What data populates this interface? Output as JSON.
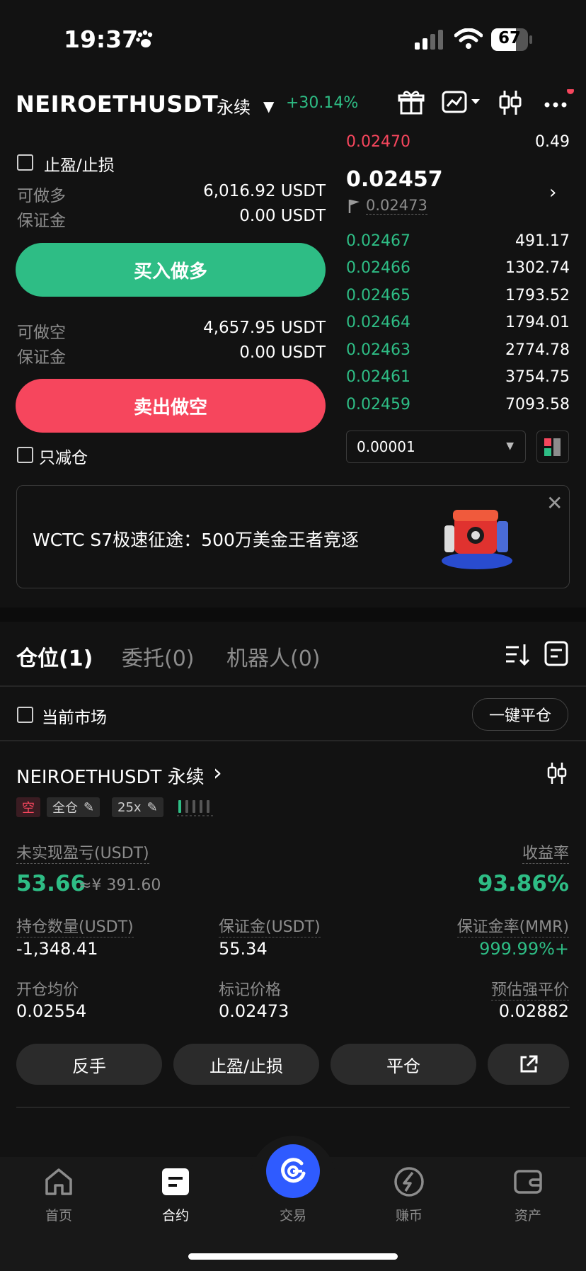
{
  "status_bar": {
    "time": "19:37",
    "battery": "67"
  },
  "header": {
    "pair": "NEIROETHUSDT",
    "contract_type": "永续",
    "change": "+30.14%"
  },
  "left_panel": {
    "tp_sl_label": "止盈/止损",
    "available_long_label": "可做多",
    "available_long_value": "6,016.92 USDT",
    "margin_long_label": "保证金",
    "margin_long_value": "0.00 USDT",
    "buy_long_label": "买入做多",
    "available_short_label": "可做空",
    "available_short_value": "4,657.95 USDT",
    "margin_short_label": "保证金",
    "margin_short_value": "0.00 USDT",
    "sell_short_label": "卖出做空",
    "reduce_only_label": "只减仓"
  },
  "order_book": {
    "ask_price": "0.02470",
    "ask_qty": "0.49",
    "last_price": "0.02457",
    "mark_price": "0.02473",
    "bids": [
      {
        "price": "0.02467",
        "qty": "491.17"
      },
      {
        "price": "0.02466",
        "qty": "1302.74"
      },
      {
        "price": "0.02465",
        "qty": "1793.52"
      },
      {
        "price": "0.02464",
        "qty": "1794.01"
      },
      {
        "price": "0.02463",
        "qty": "2774.78"
      },
      {
        "price": "0.02461",
        "qty": "3754.75"
      },
      {
        "price": "0.02459",
        "qty": "7093.58"
      }
    ],
    "precision": "0.00001"
  },
  "banner": {
    "text": "WCTC S7极速征途：500万美金王者竞逐"
  },
  "tabs": {
    "positions": "仓位(1)",
    "orders": "委托(0)",
    "bots": "机器人(0)"
  },
  "filter": {
    "current_market_label": "当前市场",
    "close_all_label": "一键平仓"
  },
  "position": {
    "title": "NEIROETHUSDT 永续",
    "side_tag": "空",
    "margin_mode_tag": "全仓",
    "leverage_tag": "25x",
    "unrealized_label": "未实现盈亏(USDT)",
    "unrealized_value": "53.66",
    "unrealized_cny": "≈¥ 391.60",
    "roi_label": "收益率",
    "roi_value": "93.86%",
    "size_label": "持仓数量(USDT)",
    "size_value": "-1,348.41",
    "margin_label": "保证金(USDT)",
    "margin_value": "55.34",
    "mmr_label": "保证金率(MMR)",
    "mmr_value": "999.99%+",
    "entry_label": "开仓均价",
    "entry_value": "0.02554",
    "mark_label": "标记价格",
    "mark_value": "0.02473",
    "liq_label": "预估强平价",
    "liq_value": "0.02882",
    "btn_reverse": "反手",
    "btn_tpsl": "止盈/止损",
    "btn_close": "平仓"
  },
  "nav": {
    "home": "首页",
    "futures": "合约",
    "trade": "交易",
    "earn": "赚币",
    "assets": "资产"
  },
  "colors": {
    "green": "#2ebd85",
    "red": "#f6465d",
    "accent": "#2f5bff",
    "background": "#121212"
  }
}
